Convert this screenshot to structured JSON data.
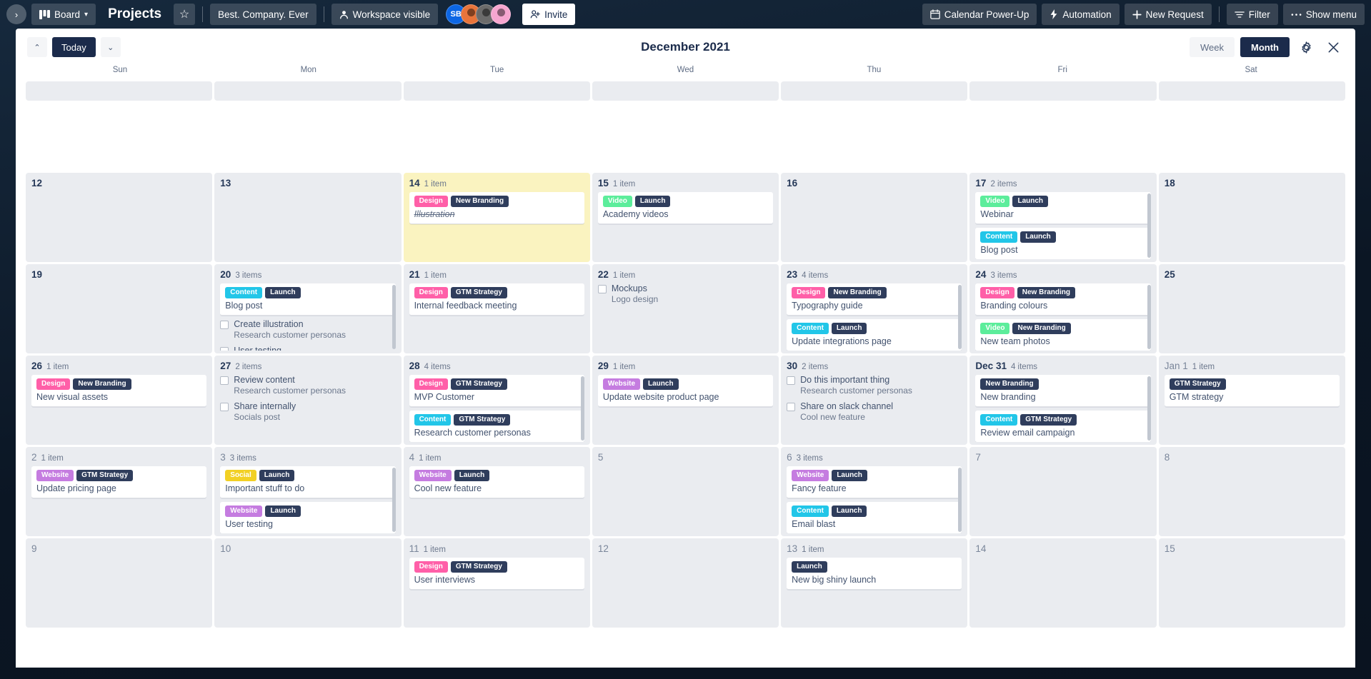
{
  "topbar": {
    "expand_label": "›",
    "board_label": "Board",
    "board_title": "Projects",
    "star_label": "☆",
    "workspace_name": "Best. Company. Ever",
    "visibility_label": "Workspace visible",
    "avatars": [
      "SB",
      "",
      "",
      ""
    ],
    "invite_label": "Invite",
    "powerup_label": "Calendar Power-Up",
    "automation_label": "Automation",
    "new_request_label": "New Request",
    "filter_label": "Filter",
    "show_menu_label": "Show menu"
  },
  "calendar": {
    "prev_label": "⌃",
    "today_label": "Today",
    "next_label": "⌄",
    "title": "December 2021",
    "view_week_label": "Week",
    "view_month_label": "Month",
    "active_view": "Month",
    "weekdays": [
      "Sun",
      "Mon",
      "Tue",
      "Wed",
      "Thu",
      "Fri",
      "Sat"
    ],
    "label_colors": {
      "Design": "#ff5fa8",
      "New Branding": "#2f3d5c",
      "Video": "#5ced9b",
      "Launch": "#2f3d5c",
      "Content": "#22c6e8",
      "GTM Strategy": "#2f3d5c",
      "Website": "#c57ce0",
      "Social": "#f2d024"
    },
    "days": [
      {
        "num": "12",
        "count": "",
        "today": false,
        "out": false,
        "items": []
      },
      {
        "num": "13",
        "count": "",
        "today": false,
        "out": false,
        "items": []
      },
      {
        "num": "14",
        "count": "1 item",
        "today": true,
        "out": false,
        "items": [
          {
            "type": "card",
            "labels": [
              "Design",
              "New Branding"
            ],
            "title": "Illustration",
            "done": true
          }
        ]
      },
      {
        "num": "15",
        "count": "1 item",
        "today": false,
        "out": false,
        "items": [
          {
            "type": "card",
            "labels": [
              "Video",
              "Launch"
            ],
            "title": "Academy videos",
            "done": false
          }
        ]
      },
      {
        "num": "16",
        "count": "",
        "today": false,
        "out": false,
        "items": []
      },
      {
        "num": "17",
        "count": "2 items",
        "today": false,
        "out": false,
        "scroll": true,
        "items": [
          {
            "type": "card",
            "labels": [
              "Video",
              "Launch"
            ],
            "title": "Webinar",
            "done": false
          },
          {
            "type": "card",
            "labels": [
              "Content",
              "Launch"
            ],
            "title": "Blog post",
            "done": false
          }
        ]
      },
      {
        "num": "18",
        "count": "",
        "today": false,
        "out": false,
        "items": []
      },
      {
        "num": "19",
        "count": "",
        "today": false,
        "out": false,
        "items": []
      },
      {
        "num": "20",
        "count": "3 items",
        "today": false,
        "out": false,
        "scroll": true,
        "items": [
          {
            "type": "card",
            "labels": [
              "Content",
              "Launch"
            ],
            "title": "Blog post",
            "done": false
          },
          {
            "type": "todo",
            "title": "Create illustration",
            "sub": "Research customer personas"
          },
          {
            "type": "todo",
            "title": "User testing",
            "sub": ""
          }
        ]
      },
      {
        "num": "21",
        "count": "1 item",
        "today": false,
        "out": false,
        "items": [
          {
            "type": "card",
            "labels": [
              "Design",
              "GTM Strategy"
            ],
            "title": "Internal feedback meeting",
            "done": false
          }
        ]
      },
      {
        "num": "22",
        "count": "1 item",
        "today": false,
        "out": false,
        "items": [
          {
            "type": "todo",
            "title": "Mockups",
            "sub": "Logo design"
          }
        ]
      },
      {
        "num": "23",
        "count": "4 items",
        "today": false,
        "out": false,
        "scroll": true,
        "items": [
          {
            "type": "card",
            "labels": [
              "Design",
              "New Branding"
            ],
            "title": "Typography guide",
            "done": false
          },
          {
            "type": "card",
            "labels": [
              "Content",
              "Launch"
            ],
            "title": "Update integrations page",
            "done": false
          }
        ]
      },
      {
        "num": "24",
        "count": "3 items",
        "today": false,
        "out": false,
        "scroll": true,
        "items": [
          {
            "type": "card",
            "labels": [
              "Design",
              "New Branding"
            ],
            "title": "Branding colours",
            "done": false
          },
          {
            "type": "card",
            "labels": [
              "Video",
              "New Branding"
            ],
            "title": "New team photos",
            "done": false
          }
        ]
      },
      {
        "num": "25",
        "count": "",
        "today": false,
        "out": false,
        "items": []
      },
      {
        "num": "26",
        "count": "1 item",
        "today": false,
        "out": false,
        "items": [
          {
            "type": "card",
            "labels": [
              "Design",
              "New Branding"
            ],
            "title": "New visual assets",
            "done": false
          }
        ]
      },
      {
        "num": "27",
        "count": "2 items",
        "today": false,
        "out": false,
        "items": [
          {
            "type": "todo",
            "title": "Review content",
            "sub": "Research customer personas"
          },
          {
            "type": "todo",
            "title": "Share internally",
            "sub": "Socials post"
          }
        ]
      },
      {
        "num": "28",
        "count": "4 items",
        "today": false,
        "out": false,
        "scroll": true,
        "items": [
          {
            "type": "card",
            "labels": [
              "Design",
              "GTM Strategy"
            ],
            "title": "MVP Customer",
            "done": false
          },
          {
            "type": "card",
            "labels": [
              "Content",
              "GTM Strategy"
            ],
            "title": "Research customer personas",
            "done": false
          }
        ]
      },
      {
        "num": "29",
        "count": "1 item",
        "today": false,
        "out": false,
        "items": [
          {
            "type": "card",
            "labels": [
              "Website",
              "Launch"
            ],
            "title": "Update website product page",
            "done": false
          }
        ]
      },
      {
        "num": "30",
        "count": "2 items",
        "today": false,
        "out": false,
        "items": [
          {
            "type": "todo",
            "title": "Do this important thing",
            "sub": "Research customer personas"
          },
          {
            "type": "todo",
            "title": "Share on slack channel",
            "sub": "Cool new feature"
          }
        ]
      },
      {
        "num": "Dec 31",
        "count": "4 items",
        "today": false,
        "out": false,
        "scroll": true,
        "items": [
          {
            "type": "card",
            "labels": [
              "New Branding"
            ],
            "title": "New branding",
            "done": false
          },
          {
            "type": "card",
            "labels": [
              "Content",
              "GTM Strategy"
            ],
            "title": "Review email campaign",
            "done": false
          }
        ]
      },
      {
        "num": "Jan 1",
        "count": "1 item",
        "today": false,
        "out": true,
        "items": [
          {
            "type": "card",
            "labels": [
              "GTM Strategy"
            ],
            "title": "GTM strategy",
            "done": false
          }
        ]
      },
      {
        "num": "2",
        "count": "1 item",
        "today": false,
        "out": true,
        "items": [
          {
            "type": "card",
            "labels": [
              "Website",
              "GTM Strategy"
            ],
            "title": "Update pricing page",
            "done": false
          }
        ]
      },
      {
        "num": "3",
        "count": "3 items",
        "today": false,
        "out": true,
        "scroll": true,
        "items": [
          {
            "type": "card",
            "labels": [
              "Social",
              "Launch"
            ],
            "title": "Important stuff to do",
            "done": false
          },
          {
            "type": "card",
            "labels": [
              "Website",
              "Launch"
            ],
            "title": "User testing",
            "done": false
          }
        ]
      },
      {
        "num": "4",
        "count": "1 item",
        "today": false,
        "out": true,
        "items": [
          {
            "type": "card",
            "labels": [
              "Website",
              "Launch"
            ],
            "title": "Cool new feature",
            "done": false
          }
        ]
      },
      {
        "num": "5",
        "count": "",
        "today": false,
        "out": true,
        "items": []
      },
      {
        "num": "6",
        "count": "3 items",
        "today": false,
        "out": true,
        "scroll": true,
        "items": [
          {
            "type": "card",
            "labels": [
              "Website",
              "Launch"
            ],
            "title": "Fancy feature",
            "done": false
          },
          {
            "type": "card",
            "labels": [
              "Content",
              "Launch"
            ],
            "title": "Email blast",
            "done": false
          }
        ]
      },
      {
        "num": "7",
        "count": "",
        "today": false,
        "out": true,
        "items": []
      },
      {
        "num": "8",
        "count": "",
        "today": false,
        "out": true,
        "items": []
      },
      {
        "num": "9",
        "count": "",
        "today": false,
        "out": true,
        "items": []
      },
      {
        "num": "10",
        "count": "",
        "today": false,
        "out": true,
        "items": []
      },
      {
        "num": "11",
        "count": "1 item",
        "today": false,
        "out": true,
        "items": [
          {
            "type": "card",
            "labels": [
              "Design",
              "GTM Strategy"
            ],
            "title": "User interviews",
            "done": false
          }
        ]
      },
      {
        "num": "12",
        "count": "",
        "today": false,
        "out": true,
        "items": []
      },
      {
        "num": "13",
        "count": "1 item",
        "today": false,
        "out": true,
        "items": [
          {
            "type": "card",
            "labels": [
              "Launch"
            ],
            "title": "New big shiny launch",
            "done": false
          }
        ]
      },
      {
        "num": "14",
        "count": "",
        "today": false,
        "out": true,
        "items": []
      },
      {
        "num": "15",
        "count": "",
        "today": false,
        "out": true,
        "items": []
      }
    ]
  }
}
